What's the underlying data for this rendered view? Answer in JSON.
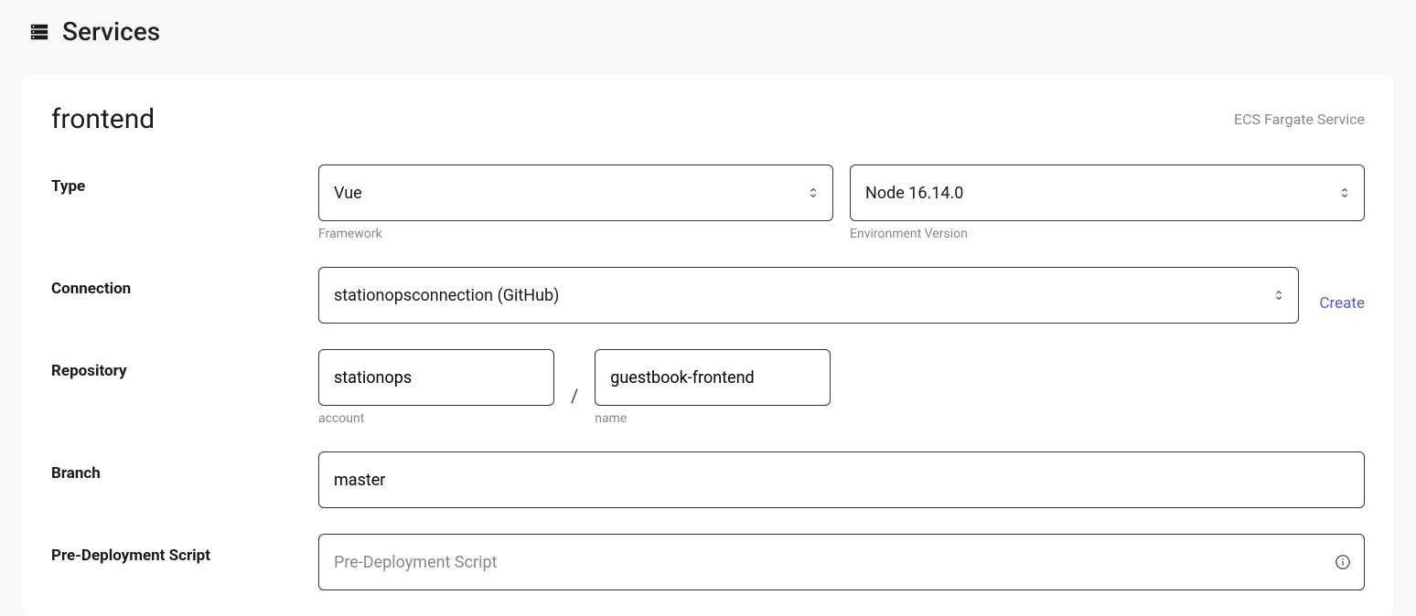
{
  "header": {
    "title": "Services"
  },
  "service": {
    "name": "frontend",
    "subtitle": "ECS Fargate Service"
  },
  "form": {
    "type": {
      "label": "Type",
      "framework": {
        "value": "Vue",
        "helper": "Framework"
      },
      "env": {
        "value": "Node 16.14.0",
        "helper": "Environment Version"
      }
    },
    "connection": {
      "label": "Connection",
      "value": "stationopsconnection (GitHub)",
      "create_label": "Create"
    },
    "repository": {
      "label": "Repository",
      "account": {
        "value": "stationops",
        "helper": "account"
      },
      "name": {
        "value": "guestbook-frontend",
        "helper": "name"
      }
    },
    "branch": {
      "label": "Branch",
      "value": "master"
    },
    "predeploy": {
      "label": "Pre-Deployment Script",
      "placeholder": "Pre-Deployment Script",
      "value": ""
    }
  }
}
